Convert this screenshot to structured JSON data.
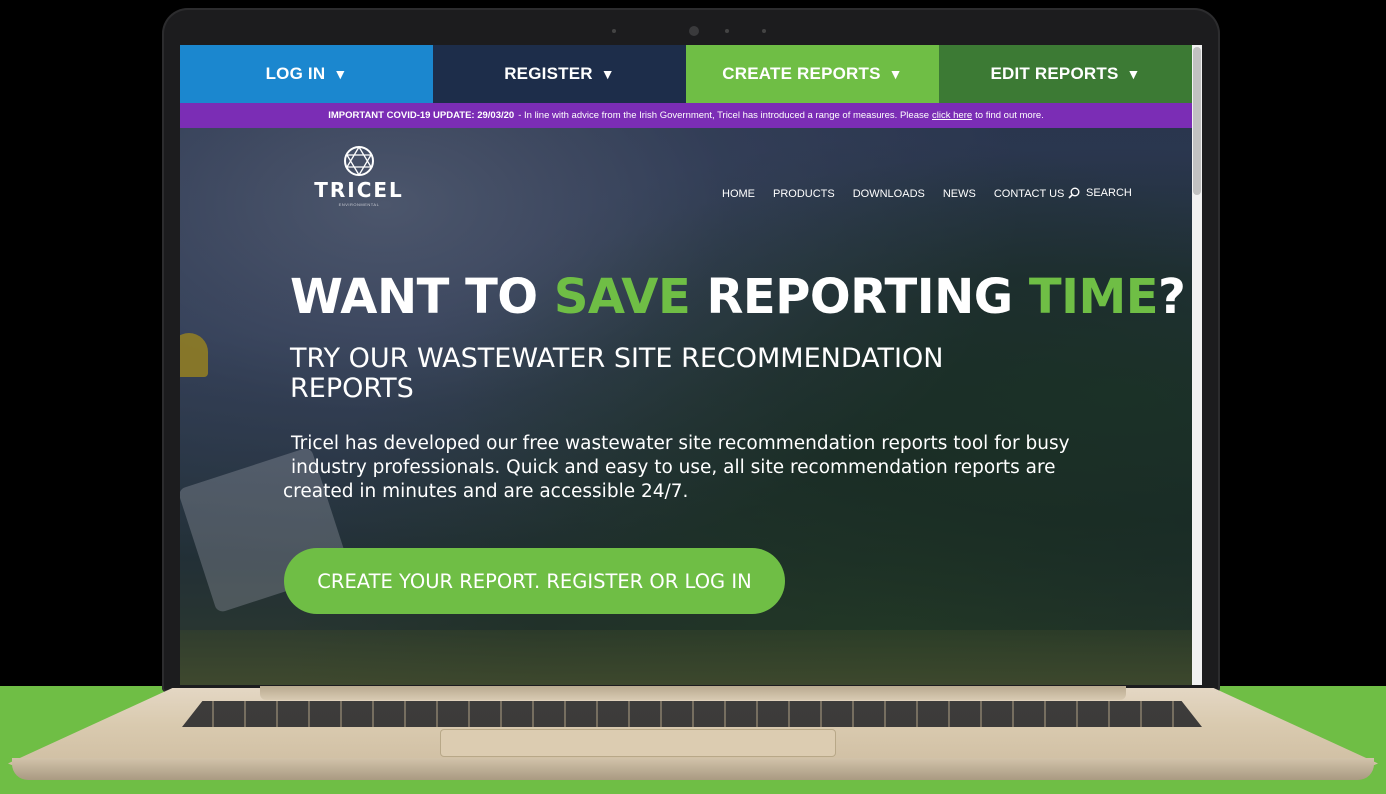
{
  "topbar": {
    "tabs": [
      {
        "label": "LOG IN",
        "color": "#1b87cf"
      },
      {
        "label": "REGISTER",
        "color": "#1d2d4a"
      },
      {
        "label": "CREATE REPORTS",
        "color": "#6fbe45"
      },
      {
        "label": "EDIT REPORTS",
        "color": "#3c7a34"
      }
    ],
    "dropdown_glyph": "▼"
  },
  "covid_banner": {
    "bold": "IMPORTANT COVID-19 UPDATE: 29/03/20",
    "text": "- In line with advice from the Irish Government, Tricel has introduced a range of measures. Please",
    "link": "click here",
    "text_after": "to find out more.",
    "color": "#7b2db5"
  },
  "logo": {
    "word": "TRICEL",
    "sub": "ENVIRONMENTAL"
  },
  "nav": {
    "items": [
      "HOME",
      "PRODUCTS",
      "DOWNLOADS",
      "NEWS",
      "CONTACT US"
    ],
    "search_label": "SEARCH"
  },
  "hero": {
    "headline": {
      "part1": "WANT TO ",
      "highlight1": "SAVE",
      "part2": " REPORTING ",
      "highlight2": "TIME",
      "part3": "?"
    },
    "subhead": "TRY OUR WASTEWATER SITE RECOMMENDATION REPORTS",
    "body_line1": "Tricel has developed our free wastewater site recommendation reports tool for busy",
    "body_line2": "industry professionals. Quick and easy to use, all site recommendation reports are",
    "body_line3": "created in minutes and are accessible 24/7.",
    "cta_label": "CREATE YOUR REPORT. REGISTER OR LOG IN",
    "accent_color": "#6fbe45"
  }
}
